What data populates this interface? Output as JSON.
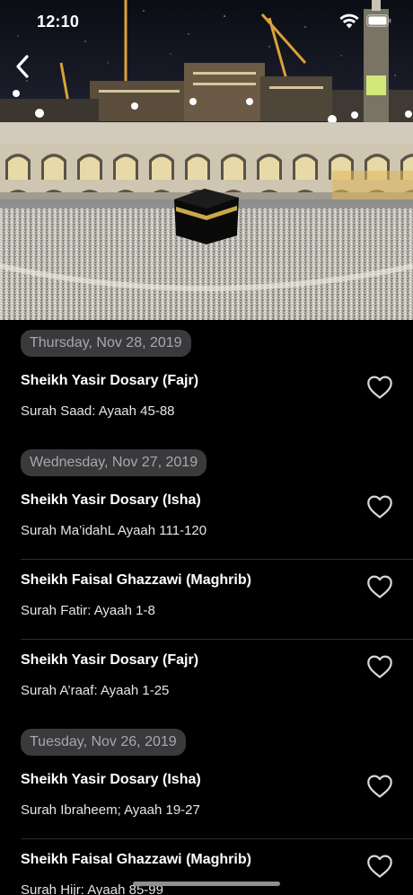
{
  "status_bar": {
    "time": "12:10"
  },
  "navigation": {
    "back_icon": "chevron-left-icon"
  },
  "hero": {
    "icon": "kaaba-photo"
  },
  "sections": [
    {
      "date": "Thursday, Nov 28, 2019",
      "items": [
        {
          "title": "Sheikh Yasir Dosary (Fajr)",
          "subtitle": "Surah Saad: Ayaah 45-88",
          "favorite": false
        }
      ]
    },
    {
      "date": "Wednesday, Nov 27, 2019",
      "items": [
        {
          "title": "Sheikh Yasir Dosary (Isha)",
          "subtitle": "Surah Ma’idahL Ayaah 111-120",
          "favorite": false
        },
        {
          "title": "Sheikh Faisal Ghazzawi (Maghrib)",
          "subtitle": "Surah Fatir: Ayaah 1-8",
          "favorite": false
        },
        {
          "title": "Sheikh Yasir Dosary (Fajr)",
          "subtitle": "Surah A’raaf: Ayaah 1-25",
          "favorite": false
        }
      ]
    },
    {
      "date": "Tuesday, Nov 26, 2019",
      "items": [
        {
          "title": "Sheikh Yasir Dosary (Isha)",
          "subtitle": "Surah Ibraheem; Ayaah 19-27",
          "favorite": false
        },
        {
          "title": "Sheikh Faisal Ghazzawi (Maghrib)",
          "subtitle": "Surah Hijr: Ayaah 85-99",
          "favorite": false
        }
      ]
    }
  ],
  "colors": {
    "background": "#000000",
    "date_pill": "#3a3a3c",
    "date_text": "#a8a8ad",
    "separator": "#2c2c2e",
    "heart_outline": "#d9d9d9"
  }
}
